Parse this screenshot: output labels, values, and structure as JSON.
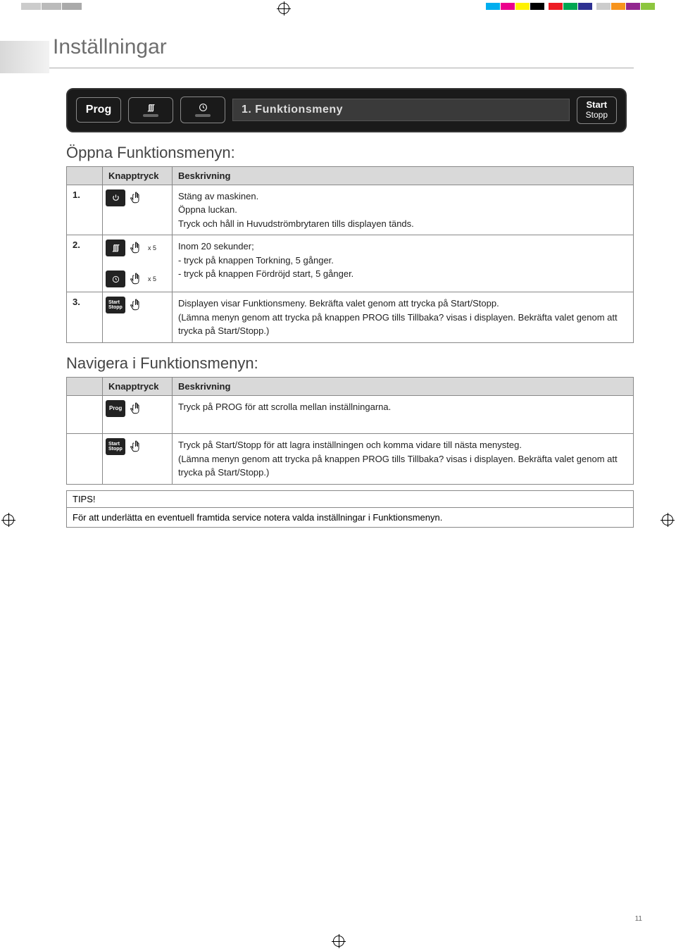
{
  "page": {
    "title": "Inställningar",
    "number": "11"
  },
  "control_panel": {
    "prog_label": "Prog",
    "display_text": "1. Funktionsmeny",
    "start_label": "Start",
    "stopp_label": "Stopp"
  },
  "section1": {
    "title": "Öppna Funktionsmenyn:",
    "header_btn": "Knapptryck",
    "header_desc": "Beskrivning",
    "rows": [
      {
        "num": "1.",
        "desc_lines": [
          "Stäng av maskinen.",
          "Öppna luckan.",
          "Tryck och håll in Huvudströmbrytaren tills displayen tänds."
        ]
      },
      {
        "num": "2.",
        "x5": "x 5",
        "desc_lines": [
          "Inom 20 sekunder;",
          "- tryck på knappen Torkning, 5 gånger.",
          "- tryck på knappen Fördröjd start, 5 gånger."
        ]
      },
      {
        "num": "3.",
        "desc_line1": "Displayen visar Funktionsmeny. Bekräfta valet genom att trycka på Start/Stopp.",
        "desc_line2": "(Lämna menyn genom att trycka på knappen PROG tills Tillbaka? visas i displayen. Bekräfta valet genom att trycka på Start/Stopp.)"
      }
    ]
  },
  "section2": {
    "title": "Navigera i Funktionsmenyn:",
    "header_btn": "Knapptryck",
    "header_desc": "Beskrivning",
    "rows": [
      {
        "desc": "Tryck på PROG för att scrolla mellan inställningarna."
      },
      {
        "desc_line1": "Tryck på Start/Stopp för att lagra inställningen och komma vidare till nästa menysteg.",
        "desc_line2": "(Lämna menyn genom att trycka på knappen PROG tills Tillbaka? visas i displayen. Bekräfta valet genom att trycka på Start/Stopp.)"
      }
    ]
  },
  "tips": {
    "heading": "TIPS!",
    "body": "För att underlätta en eventuell framtida service notera valda inställningar i Funktionsmenyn."
  },
  "icons": {
    "prog": "Prog",
    "start": "Start",
    "stopp": "Stopp"
  }
}
